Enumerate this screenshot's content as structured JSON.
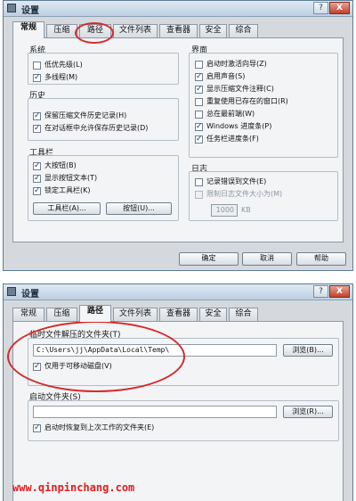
{
  "window1": {
    "title": "设置",
    "help": "?",
    "close": "X",
    "tabs": [
      "常规",
      "压缩",
      "路径",
      "文件列表",
      "查看器",
      "安全",
      "综合"
    ],
    "active_tab": "常规",
    "system": {
      "title": "系统",
      "items": [
        {
          "label": "低优先级(L)",
          "checked": false
        },
        {
          "label": "多线程(M)",
          "checked": true
        }
      ]
    },
    "history": {
      "title": "历史",
      "items": [
        {
          "label": "保留压缩文件历史记录(H)",
          "checked": true
        },
        {
          "label": "在对话框中允许保存历史记录(D)",
          "checked": true
        }
      ]
    },
    "toolbar": {
      "title": "工具栏",
      "items": [
        {
          "label": "大按钮(B)",
          "checked": true
        },
        {
          "label": "显示按钮文本(T)",
          "checked": true
        },
        {
          "label": "锁定工具栏(K)",
          "checked": true
        }
      ],
      "toolbar_button": "工具栏(A)...",
      "buttons_button": "按钮(U)..."
    },
    "interface": {
      "title": "界面",
      "items": [
        {
          "label": "启动时激活向导(Z)",
          "checked": false
        },
        {
          "label": "启用声音(S)",
          "checked": true
        },
        {
          "label": "显示压缩文件注释(C)",
          "checked": true
        },
        {
          "label": "重复使用已存在的窗口(R)",
          "checked": false
        },
        {
          "label": "总在最前端(W)",
          "checked": false
        },
        {
          "label": "Windows 进度条(P)",
          "checked": true
        },
        {
          "label": "任务栏进度条(F)",
          "checked": true
        }
      ]
    },
    "log": {
      "title": "日志",
      "items": [
        {
          "label": "记录错误到文件(E)",
          "checked": false
        },
        {
          "label": "限制日志文件大小为(M)",
          "checked": false,
          "disabled": true
        }
      ],
      "size_value": "1000",
      "size_unit": "KB"
    },
    "footer": {
      "ok": "确定",
      "cancel": "取消",
      "help": "帮助"
    }
  },
  "window2": {
    "title": "设置",
    "help": "?",
    "close": "X",
    "tabs": [
      "常规",
      "压缩",
      "路径",
      "文件列表",
      "查看器",
      "安全",
      "综合"
    ],
    "active_tab": "路径",
    "temp_folder": {
      "title": "临时文件解压的文件夹(T)",
      "path": "C:\\Users\\jj\\AppData\\Local\\Temp\\",
      "browse": "浏览(B)...",
      "removable_only": {
        "label": "仅用于可移动磁盘(V)",
        "checked": true
      }
    },
    "startup_folder": {
      "title": "启动文件夹(S)",
      "path": "",
      "browse": "浏览(R)...",
      "restore_last": {
        "label": "启动时恢复到上次工作的文件夹(E)",
        "checked": true
      }
    }
  },
  "watermark": "www.qinpinchang.com",
  "colors": {
    "annotation_red": "#d52a2a",
    "watermark_red": "#e61b1b",
    "dialog_bg": "#d5d9de"
  }
}
